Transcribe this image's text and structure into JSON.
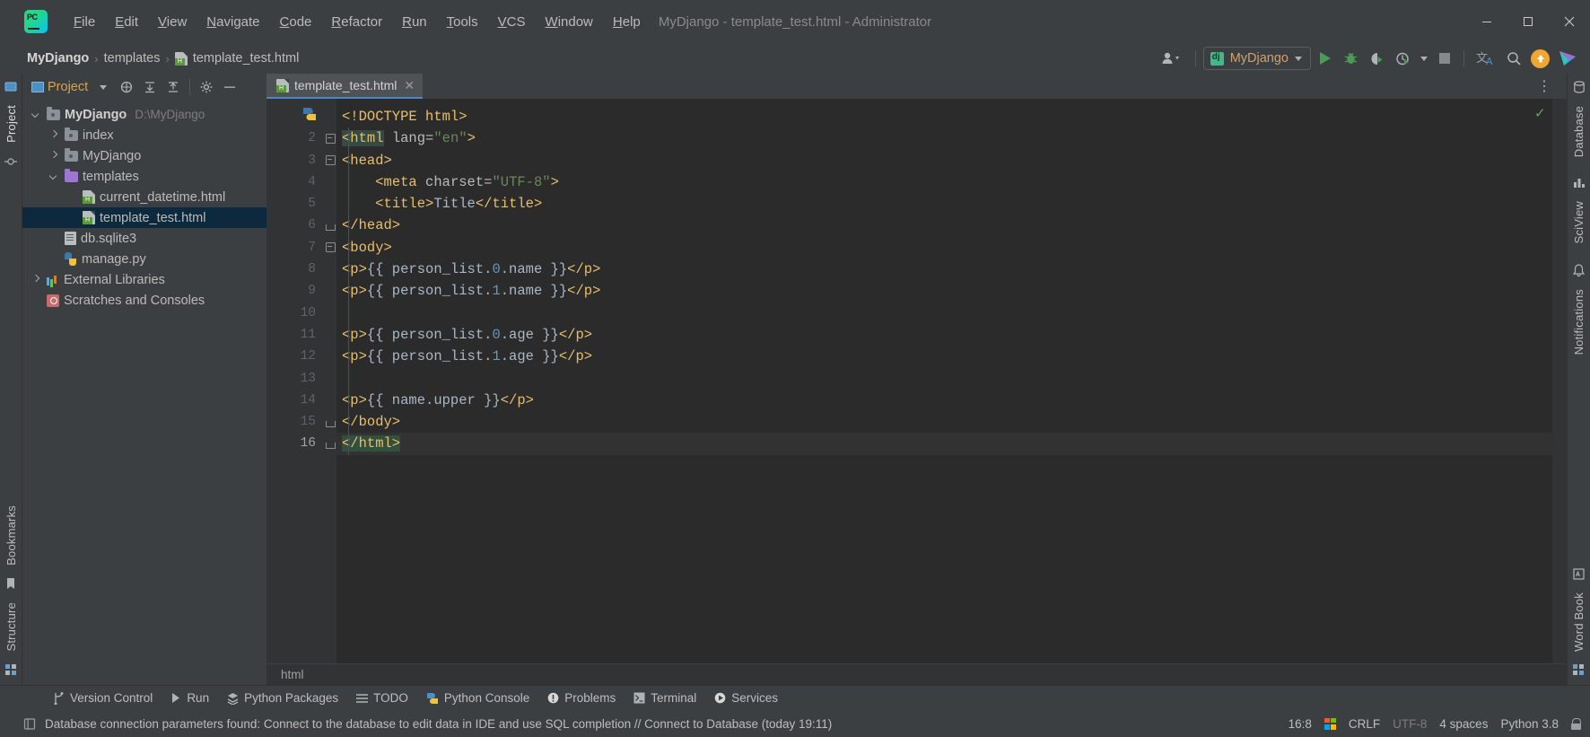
{
  "window": {
    "title": "MyDjango - template_test.html - Administrator",
    "minimize": "─",
    "maximize": "☐",
    "close": "✕"
  },
  "menu": {
    "items": [
      {
        "label": "File",
        "name": "menu-file"
      },
      {
        "label": "Edit",
        "name": "menu-edit"
      },
      {
        "label": "View",
        "name": "menu-view"
      },
      {
        "label": "Navigate",
        "name": "menu-navigate"
      },
      {
        "label": "Code",
        "name": "menu-code"
      },
      {
        "label": "Refactor",
        "name": "menu-refactor"
      },
      {
        "label": "Run",
        "name": "menu-run"
      },
      {
        "label": "Tools",
        "name": "menu-tools"
      },
      {
        "label": "VCS",
        "name": "menu-vcs"
      },
      {
        "label": "Window",
        "name": "menu-window"
      },
      {
        "label": "Help",
        "name": "menu-help"
      }
    ]
  },
  "breadcrumb": {
    "project": "MyDjango",
    "folder": "templates",
    "file": "template_test.html",
    "separator": "›"
  },
  "toolbar": {
    "run_config": "MyDjango",
    "icons": [
      "user-account-icon",
      "run-icon",
      "debug-icon",
      "run-coverage-icon",
      "profile-icon",
      "stop-icon",
      "translate-icon",
      "search-everywhere-icon",
      "update-icon",
      "ide-feature-icon"
    ]
  },
  "project_panel": {
    "title": "Project",
    "header_icons": [
      "scope-icon",
      "collapse-all-icon",
      "expand-all-icon",
      "settings-icon",
      "hide-icon"
    ],
    "tree": [
      {
        "label": "MyDjango",
        "sub": "D:\\MyDjango",
        "icon": "folder-root",
        "indent": 0,
        "arrow": "down",
        "bold": true,
        "selected": false
      },
      {
        "label": "index",
        "sub": "",
        "icon": "folder-module",
        "indent": 1,
        "arrow": "right",
        "bold": false,
        "selected": false
      },
      {
        "label": "MyDjango",
        "sub": "",
        "icon": "folder-module",
        "indent": 1,
        "arrow": "right",
        "bold": false,
        "selected": false
      },
      {
        "label": "templates",
        "sub": "",
        "icon": "folder-template",
        "indent": 1,
        "arrow": "down",
        "bold": false,
        "selected": false
      },
      {
        "label": "current_datetime.html",
        "sub": "",
        "icon": "file-html",
        "indent": 2,
        "arrow": "none",
        "bold": false,
        "selected": false
      },
      {
        "label": "template_test.html",
        "sub": "",
        "icon": "file-html",
        "indent": 2,
        "arrow": "none",
        "bold": false,
        "selected": true
      },
      {
        "label": "db.sqlite3",
        "sub": "",
        "icon": "file-db",
        "indent": 1,
        "arrow": "none",
        "bold": false,
        "selected": false
      },
      {
        "label": "manage.py",
        "sub": "",
        "icon": "file-python",
        "indent": 1,
        "arrow": "none",
        "bold": false,
        "selected": false
      },
      {
        "label": "External Libraries",
        "sub": "",
        "icon": "libraries",
        "indent": 0,
        "arrow": "right",
        "bold": false,
        "selected": false
      },
      {
        "label": "Scratches and Consoles",
        "sub": "",
        "icon": "scratches",
        "indent": 0,
        "arrow": "none",
        "bold": false,
        "selected": false
      }
    ]
  },
  "left_strip": {
    "labels": [
      "Project",
      "Bookmarks",
      "Structure"
    ]
  },
  "right_strip": {
    "labels": [
      "Database",
      "SciView",
      "Notifications",
      "Word Book"
    ]
  },
  "editor": {
    "tab": {
      "label": "template_test.html",
      "close": "✕"
    },
    "breadcrumb": "html",
    "inspection_ok": "✓",
    "lines": [
      {
        "n": 1,
        "cur": false,
        "fold": "none",
        "tokens": [
          {
            "t": "tag",
            "v": "<!DOCTYPE html>"
          }
        ]
      },
      {
        "n": 2,
        "cur": false,
        "fold": "top",
        "tokens": [
          {
            "t": "tag sel-tag",
            "v": "<html"
          },
          {
            "t": "txt",
            "v": " "
          },
          {
            "t": "attr",
            "v": "lang="
          },
          {
            "t": "str",
            "v": "\"en\""
          },
          {
            "t": "tag",
            "v": ">"
          }
        ]
      },
      {
        "n": 3,
        "cur": false,
        "fold": "top",
        "tokens": [
          {
            "t": "tag",
            "v": "<head>"
          }
        ]
      },
      {
        "n": 4,
        "cur": false,
        "fold": "none",
        "tokens": [
          {
            "t": "txt",
            "v": "    "
          },
          {
            "t": "tag",
            "v": "<meta"
          },
          {
            "t": "txt",
            "v": " "
          },
          {
            "t": "attr",
            "v": "charset="
          },
          {
            "t": "str",
            "v": "\"UTF-8\""
          },
          {
            "t": "tag",
            "v": ">"
          }
        ]
      },
      {
        "n": 5,
        "cur": false,
        "fold": "none",
        "tokens": [
          {
            "t": "txt",
            "v": "    "
          },
          {
            "t": "tag",
            "v": "<title>"
          },
          {
            "t": "txt",
            "v": "Title"
          },
          {
            "t": "tag",
            "v": "</title>"
          }
        ]
      },
      {
        "n": 6,
        "cur": false,
        "fold": "end",
        "tokens": [
          {
            "t": "tag",
            "v": "</head>"
          }
        ]
      },
      {
        "n": 7,
        "cur": false,
        "fold": "top",
        "tokens": [
          {
            "t": "tag",
            "v": "<body>"
          }
        ]
      },
      {
        "n": 8,
        "cur": false,
        "fold": "none",
        "tokens": [
          {
            "t": "tag",
            "v": "<p>"
          },
          {
            "t": "brace",
            "v": "{{ person_list."
          },
          {
            "t": "num",
            "v": "0"
          },
          {
            "t": "brace",
            "v": ".name }}"
          },
          {
            "t": "tag",
            "v": "</p>"
          }
        ]
      },
      {
        "n": 9,
        "cur": false,
        "fold": "none",
        "tokens": [
          {
            "t": "tag",
            "v": "<p>"
          },
          {
            "t": "brace",
            "v": "{{ person_list."
          },
          {
            "t": "num",
            "v": "1"
          },
          {
            "t": "brace",
            "v": ".name }}"
          },
          {
            "t": "tag",
            "v": "</p>"
          }
        ]
      },
      {
        "n": 10,
        "cur": false,
        "fold": "none",
        "tokens": []
      },
      {
        "n": 11,
        "cur": false,
        "fold": "none",
        "tokens": [
          {
            "t": "tag",
            "v": "<p>"
          },
          {
            "t": "brace",
            "v": "{{ person_list."
          },
          {
            "t": "num",
            "v": "0"
          },
          {
            "t": "brace",
            "v": ".age }}"
          },
          {
            "t": "tag",
            "v": "</p>"
          }
        ]
      },
      {
        "n": 12,
        "cur": false,
        "fold": "none",
        "tokens": [
          {
            "t": "tag",
            "v": "<p>"
          },
          {
            "t": "brace",
            "v": "{{ person_list."
          },
          {
            "t": "num",
            "v": "1"
          },
          {
            "t": "brace",
            "v": ".age }}"
          },
          {
            "t": "tag",
            "v": "</p>"
          }
        ]
      },
      {
        "n": 13,
        "cur": false,
        "fold": "none",
        "tokens": []
      },
      {
        "n": 14,
        "cur": false,
        "fold": "none",
        "tokens": [
          {
            "t": "tag",
            "v": "<p>"
          },
          {
            "t": "brace",
            "v": "{{ name.upper }}"
          },
          {
            "t": "tag",
            "v": "</p>"
          }
        ]
      },
      {
        "n": 15,
        "cur": false,
        "fold": "end",
        "tokens": [
          {
            "t": "tag",
            "v": "</body>"
          }
        ]
      },
      {
        "n": 16,
        "cur": true,
        "fold": "end",
        "tokens": [
          {
            "t": "tag sel-green",
            "v": "</html>"
          }
        ]
      }
    ]
  },
  "tool_windows": [
    {
      "label": "Version Control",
      "icon": "branch-icon",
      "name": "tool-version-control"
    },
    {
      "label": "Run",
      "icon": "play-icon",
      "name": "tool-run"
    },
    {
      "label": "Python Packages",
      "icon": "packages-icon",
      "name": "tool-python-packages"
    },
    {
      "label": "TODO",
      "icon": "list-icon",
      "name": "tool-todo"
    },
    {
      "label": "Python Console",
      "icon": "python-icon",
      "name": "tool-python-console"
    },
    {
      "label": "Problems",
      "icon": "warning-icon",
      "name": "tool-problems"
    },
    {
      "label": "Terminal",
      "icon": "terminal-icon",
      "name": "tool-terminal"
    },
    {
      "label": "Services",
      "icon": "services-icon",
      "name": "tool-services"
    }
  ],
  "statusbar": {
    "message": "Database connection parameters found: Connect to the database to edit data in IDE and use SQL completion // Connect to Database (today 19:11)",
    "caret": "16:8",
    "line_separator": "CRLF",
    "encoding": "UTF-8",
    "indent": "4 spaces",
    "interpreter": "Python 3.8"
  },
  "colors": {
    "accent_tab": "#4a88c7",
    "selection_tree": "#0d293e",
    "run_green": "#499c54",
    "update_orange": "#f0a732",
    "tag_orange": "#e8bf6a",
    "string_green": "#6a8759",
    "number_blue": "#6897bb"
  }
}
